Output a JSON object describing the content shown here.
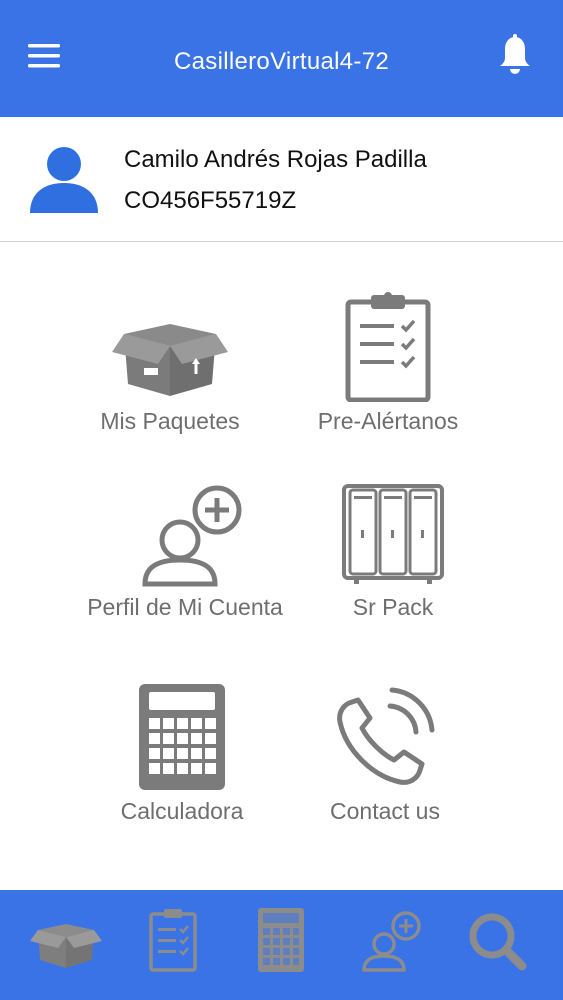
{
  "app_bar": {
    "title": "CasilleroVirtual4-72",
    "menu_icon": "hamburger-menu-icon",
    "bell_icon": "bell-icon"
  },
  "profile": {
    "name": "Camilo Andrés Rojas Padilla",
    "code": "CO456F55719Z",
    "avatar_icon": "user-avatar-icon"
  },
  "tiles": [
    {
      "label": "Mis Paquetes",
      "icon": "package-box-icon"
    },
    {
      "label": "Pre-Alértanos",
      "icon": "clipboard-checklist-icon"
    },
    {
      "label": "Perfil de Mi Cuenta",
      "icon": "user-add-icon"
    },
    {
      "label": "Sr Pack",
      "icon": "lockers-icon"
    },
    {
      "label": "Calculadora",
      "icon": "calculator-icon"
    },
    {
      "label": "Contact us",
      "icon": "phone-icon"
    }
  ],
  "bottom_nav": [
    {
      "icon": "package-box-icon"
    },
    {
      "icon": "clipboard-checklist-icon"
    },
    {
      "icon": "calculator-icon"
    },
    {
      "icon": "user-add-icon"
    },
    {
      "icon": "search-icon"
    }
  ],
  "colors": {
    "primary": "#3a73e6",
    "icon_gray": "#7b7b7b",
    "nav_icon_gray": "#8c8c8c",
    "avatar_blue": "#2f6fe0"
  }
}
